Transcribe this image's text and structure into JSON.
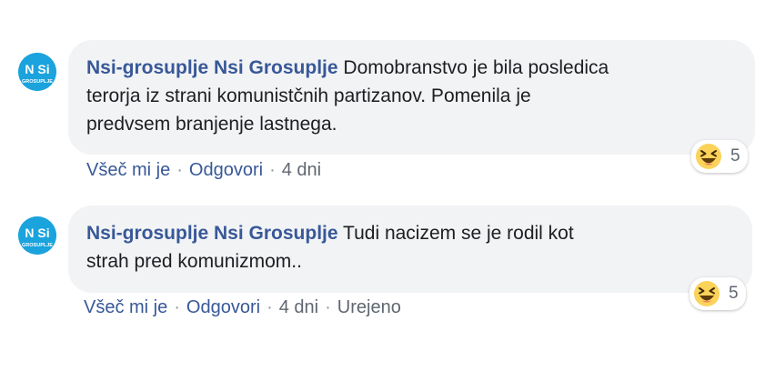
{
  "colors": {
    "author": "#385898",
    "bubble_bg": "#f2f3f5",
    "meta_text": "#606770",
    "avatar_bg": "#1aa3dd",
    "haha_face": "#fbd25a"
  },
  "comments": [
    {
      "author": "Nsi-grosuplje Nsi Grosuplje",
      "text_lines": [
        "Domobranstvo je bila posledica",
        "terorja iz strani komunistčnih partizanov. Pomenila je",
        "predvsem branjenje lastnega."
      ],
      "avatar": {
        "top_text": "N Si",
        "bottom_text": "GROSUPLJE"
      },
      "reaction": {
        "icon": "haha-icon",
        "count": "5"
      },
      "actions": {
        "like": "Všeč mi je",
        "reply": "Odgovori",
        "time": "4 dni"
      }
    },
    {
      "author": "Nsi-grosuplje Nsi Grosuplje",
      "text_lines": [
        "Tudi nacizem se je rodil kot",
        "strah pred komunizmom.."
      ],
      "avatar": {
        "top_text": "N Si",
        "bottom_text": "GROSUPLJE"
      },
      "reaction": {
        "icon": "haha-icon",
        "count": "5"
      },
      "actions": {
        "like": "Všeč mi je",
        "reply": "Odgovori",
        "time": "4 dni",
        "edited": "Urejeno"
      }
    }
  ]
}
